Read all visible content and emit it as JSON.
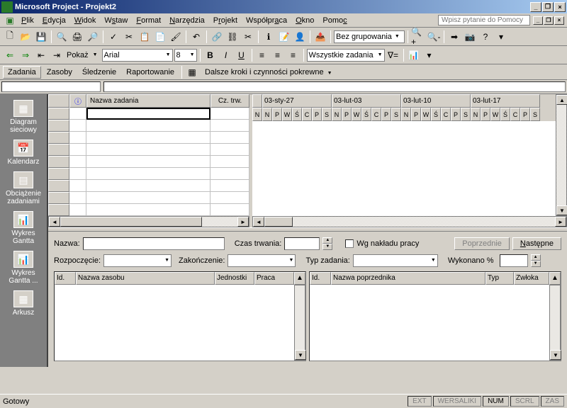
{
  "title": "Microsoft Project - Projekt2",
  "help_placeholder": "Wpisz pytanie do Pomocy",
  "menu": {
    "plik": "Plik",
    "edycja": "Edycja",
    "widok": "Widok",
    "wstaw": "Wstaw",
    "format": "Format",
    "narzedzia": "Narzędzia",
    "projekt": "Projekt",
    "wspolpraca": "Współpraca",
    "okno": "Okno",
    "pomoc": "Pomoc"
  },
  "toolbar2": {
    "pokaz": "Pokaż",
    "font": "Arial",
    "size": "8",
    "grouping": "Bez grupowania",
    "filter": "Wszystkie zadania"
  },
  "viewbar": {
    "zadania": "Zadania",
    "zasoby": "Zasoby",
    "sledzenie": "Śledzenie",
    "raportowanie": "Raportowanie",
    "dalsze": "Dalsze kroki i czynności pokrewne"
  },
  "views": {
    "diagram": "Diagram sieciowy",
    "kalendarz": "Kalendarz",
    "obciazenie": "Obciążenie zadaniami",
    "gantt": "Wykres Gantta",
    "gantt2": "Wykres Gantta ...",
    "arkusz": "Arkusz"
  },
  "grid_headers": {
    "info": "ⓘ",
    "nazwa": "Nazwa zadania",
    "czas": "Cz. trw."
  },
  "gantt_weeks": [
    "03-sty-27",
    "03-lut-03",
    "03-lut-10",
    "03-lut-17"
  ],
  "gantt_days": [
    "N",
    "P",
    "W",
    "Ś",
    "C",
    "P",
    "S"
  ],
  "form": {
    "nazwa": "Nazwa:",
    "czas_trwania": "Czas trwania:",
    "wg_nakladu": "Wg nakładu pracy",
    "poprzednie": "Poprzednie",
    "nastepne": "Następne",
    "rozpoczecie": "Rozpoczęcie:",
    "zakonczenie": "Zakończenie:",
    "typ_zadania": "Typ zadania:",
    "wykonano": "Wykonano %"
  },
  "subtable1": {
    "id": "Id.",
    "nazwa_zasobu": "Nazwa zasobu",
    "jednostki": "Jednostki",
    "praca": "Praca"
  },
  "subtable2": {
    "id": "Id.",
    "nazwa_poprz": "Nazwa poprzednika",
    "typ": "Typ",
    "zwloka": "Zwłoka"
  },
  "status": {
    "gotowy": "Gotowy",
    "ext": "EXT",
    "wersaliki": "WERSALIKI",
    "num": "NUM",
    "scrl": "SCRL",
    "zas": "ZAS"
  }
}
